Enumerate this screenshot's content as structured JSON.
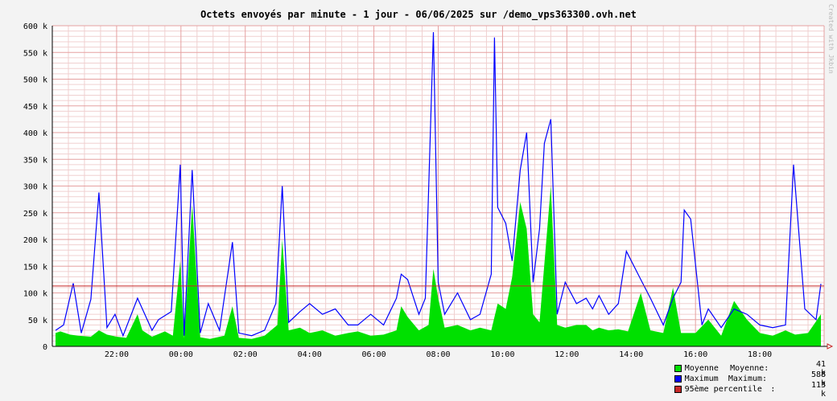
{
  "chart_data": {
    "type": "area",
    "title": "Octets envoyés par minute - 1 jour - 06/06/2025 sur /demo_vps363300.ovh.net",
    "watermark": "Created with Jkbin",
    "ylim": [
      0,
      600000
    ],
    "y_ticks": [
      "0",
      "50 k",
      "100 k",
      "150 k",
      "200 k",
      "250 k",
      "300 k",
      "350 k",
      "400 k",
      "450 k",
      "500 k",
      "550 k",
      "600 k"
    ],
    "x_ticks": [
      "22:00",
      "00:00",
      "02:00",
      "04:00",
      "06:00",
      "08:00",
      "10:00",
      "12:00",
      "14:00",
      "16:00",
      "18:00"
    ],
    "x_range_hours": [
      20.0,
      44.0
    ],
    "grid": true,
    "percentile_95": 113000,
    "series": [
      {
        "name": "Moyenne",
        "color": "#00e000",
        "type": "area",
        "points": [
          [
            20.1,
            25000
          ],
          [
            20.25,
            28000
          ],
          [
            20.55,
            22000
          ],
          [
            20.8,
            20000
          ],
          [
            21.2,
            18000
          ],
          [
            21.45,
            30000
          ],
          [
            21.7,
            22000
          ],
          [
            22.0,
            18000
          ],
          [
            22.3,
            16000
          ],
          [
            22.65,
            60000
          ],
          [
            22.8,
            30000
          ],
          [
            23.1,
            18000
          ],
          [
            23.5,
            28000
          ],
          [
            23.75,
            20000
          ],
          [
            23.98,
            160000
          ],
          [
            24.1,
            15000
          ],
          [
            24.35,
            265000
          ],
          [
            24.6,
            17000
          ],
          [
            24.9,
            14000
          ],
          [
            25.35,
            20000
          ],
          [
            25.6,
            75000
          ],
          [
            25.8,
            16000
          ],
          [
            26.2,
            14000
          ],
          [
            26.6,
            20000
          ],
          [
            27.0,
            40000
          ],
          [
            27.15,
            200000
          ],
          [
            27.35,
            30000
          ],
          [
            27.7,
            35000
          ],
          [
            28.0,
            25000
          ],
          [
            28.4,
            30000
          ],
          [
            28.8,
            20000
          ],
          [
            29.2,
            25000
          ],
          [
            29.5,
            28000
          ],
          [
            29.9,
            20000
          ],
          [
            30.3,
            22000
          ],
          [
            30.7,
            30000
          ],
          [
            30.85,
            75000
          ],
          [
            31.05,
            55000
          ],
          [
            31.4,
            30000
          ],
          [
            31.7,
            40000
          ],
          [
            31.85,
            145000
          ],
          [
            32.0,
            90000
          ],
          [
            32.2,
            35000
          ],
          [
            32.6,
            40000
          ],
          [
            33.0,
            30000
          ],
          [
            33.3,
            35000
          ],
          [
            33.65,
            30000
          ],
          [
            33.85,
            80000
          ],
          [
            34.1,
            70000
          ],
          [
            34.3,
            130000
          ],
          [
            34.55,
            270000
          ],
          [
            34.75,
            220000
          ],
          [
            34.95,
            60000
          ],
          [
            35.15,
            45000
          ],
          [
            35.5,
            300000
          ],
          [
            35.7,
            40000
          ],
          [
            35.95,
            35000
          ],
          [
            36.3,
            40000
          ],
          [
            36.6,
            40000
          ],
          [
            36.8,
            30000
          ],
          [
            37.0,
            35000
          ],
          [
            37.3,
            30000
          ],
          [
            37.6,
            32000
          ],
          [
            37.9,
            28000
          ],
          [
            38.3,
            100000
          ],
          [
            38.6,
            30000
          ],
          [
            39.0,
            25000
          ],
          [
            39.3,
            110000
          ],
          [
            39.55,
            25000
          ],
          [
            40.0,
            25000
          ],
          [
            40.4,
            50000
          ],
          [
            40.8,
            20000
          ],
          [
            41.2,
            85000
          ],
          [
            41.6,
            50000
          ],
          [
            42.0,
            25000
          ],
          [
            42.4,
            20000
          ],
          [
            42.8,
            30000
          ],
          [
            43.1,
            22000
          ],
          [
            43.5,
            25000
          ],
          [
            43.9,
            60000
          ]
        ]
      },
      {
        "name": "Maximum",
        "color": "#0000ff",
        "type": "line",
        "points": [
          [
            20.1,
            30000
          ],
          [
            20.35,
            40000
          ],
          [
            20.65,
            118000
          ],
          [
            20.9,
            25000
          ],
          [
            21.2,
            88000
          ],
          [
            21.45,
            288000
          ],
          [
            21.7,
            35000
          ],
          [
            21.95,
            60000
          ],
          [
            22.2,
            20000
          ],
          [
            22.65,
            90000
          ],
          [
            22.8,
            70000
          ],
          [
            23.1,
            30000
          ],
          [
            23.3,
            50000
          ],
          [
            23.7,
            65000
          ],
          [
            23.98,
            340000
          ],
          [
            24.1,
            20000
          ],
          [
            24.35,
            330000
          ],
          [
            24.6,
            25000
          ],
          [
            24.85,
            80000
          ],
          [
            25.2,
            30000
          ],
          [
            25.6,
            195000
          ],
          [
            25.8,
            25000
          ],
          [
            26.2,
            20000
          ],
          [
            26.6,
            30000
          ],
          [
            26.95,
            80000
          ],
          [
            27.15,
            300000
          ],
          [
            27.35,
            45000
          ],
          [
            27.7,
            65000
          ],
          [
            28.0,
            80000
          ],
          [
            28.4,
            60000
          ],
          [
            28.8,
            70000
          ],
          [
            29.2,
            40000
          ],
          [
            29.5,
            40000
          ],
          [
            29.9,
            60000
          ],
          [
            30.3,
            40000
          ],
          [
            30.7,
            90000
          ],
          [
            30.85,
            135000
          ],
          [
            31.05,
            125000
          ],
          [
            31.4,
            60000
          ],
          [
            31.6,
            90000
          ],
          [
            31.85,
            588000
          ],
          [
            32.0,
            120000
          ],
          [
            32.2,
            60000
          ],
          [
            32.6,
            100000
          ],
          [
            33.0,
            50000
          ],
          [
            33.3,
            60000
          ],
          [
            33.65,
            135000
          ],
          [
            33.75,
            578000
          ],
          [
            33.85,
            260000
          ],
          [
            34.1,
            230000
          ],
          [
            34.3,
            160000
          ],
          [
            34.55,
            330000
          ],
          [
            34.75,
            400000
          ],
          [
            34.95,
            120000
          ],
          [
            35.15,
            220000
          ],
          [
            35.3,
            380000
          ],
          [
            35.5,
            425000
          ],
          [
            35.7,
            60000
          ],
          [
            35.95,
            120000
          ],
          [
            36.3,
            80000
          ],
          [
            36.6,
            90000
          ],
          [
            36.8,
            70000
          ],
          [
            37.0,
            95000
          ],
          [
            37.3,
            60000
          ],
          [
            37.6,
            80000
          ],
          [
            37.85,
            178000
          ],
          [
            38.3,
            125000
          ],
          [
            38.6,
            90000
          ],
          [
            39.0,
            40000
          ],
          [
            39.3,
            90000
          ],
          [
            39.55,
            120000
          ],
          [
            39.65,
            255000
          ],
          [
            39.85,
            238000
          ],
          [
            40.2,
            40000
          ],
          [
            40.4,
            70000
          ],
          [
            40.8,
            35000
          ],
          [
            41.2,
            70000
          ],
          [
            41.6,
            60000
          ],
          [
            42.0,
            40000
          ],
          [
            42.4,
            35000
          ],
          [
            42.8,
            40000
          ],
          [
            43.05,
            340000
          ],
          [
            43.4,
            70000
          ],
          [
            43.75,
            50000
          ],
          [
            43.9,
            117000
          ]
        ]
      }
    ]
  },
  "legend": {
    "items": [
      {
        "name": "Moyenne",
        "label": "Moyenne:",
        "value": "41 k",
        "color": "#00e000"
      },
      {
        "name": "Maximum",
        "label": "Maximum:",
        "value": "588 k",
        "color": "#0000ff"
      },
      {
        "name": "95ème percentile",
        "label": ":",
        "value": "113 k",
        "color": "#c82828"
      }
    ]
  }
}
